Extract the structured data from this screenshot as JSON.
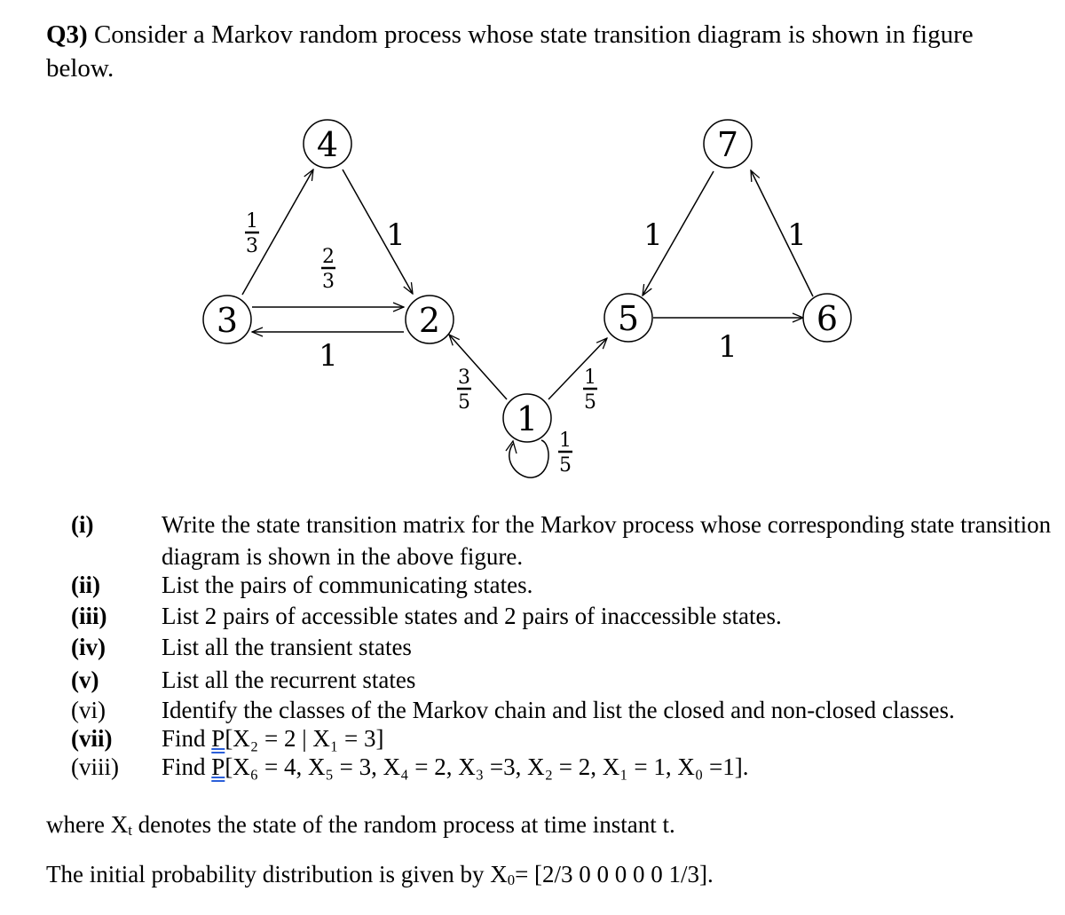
{
  "question": {
    "number": "Q3)",
    "text": "Consider a Markov random process whose state transition diagram is shown in figure below."
  },
  "diagram": {
    "states": [
      {
        "id": "1",
        "label": "1"
      },
      {
        "id": "2",
        "label": "2"
      },
      {
        "id": "3",
        "label": "3"
      },
      {
        "id": "4",
        "label": "4"
      },
      {
        "id": "5",
        "label": "5"
      },
      {
        "id": "6",
        "label": "6"
      },
      {
        "id": "7",
        "label": "7"
      }
    ],
    "transitions": [
      {
        "from": "3",
        "to": "4",
        "prob": "1/3",
        "num": "1",
        "den": "3"
      },
      {
        "from": "3",
        "to": "2",
        "prob": "2/3",
        "num": "2",
        "den": "3"
      },
      {
        "from": "2",
        "to": "3",
        "prob": "1"
      },
      {
        "from": "4",
        "to": "2",
        "prob": "1"
      },
      {
        "from": "1",
        "to": "2",
        "prob": "3/5",
        "num": "3",
        "den": "5"
      },
      {
        "from": "1",
        "to": "5",
        "prob": "1/5",
        "num": "1",
        "den": "5"
      },
      {
        "from": "1",
        "to": "1",
        "prob": "1/5",
        "num": "1",
        "den": "5"
      },
      {
        "from": "5",
        "to": "6",
        "prob": "1"
      },
      {
        "from": "6",
        "to": "7",
        "prob": "1"
      },
      {
        "from": "7",
        "to": "5",
        "prob": "1"
      }
    ]
  },
  "items": [
    {
      "label": "(i)",
      "bold": true,
      "text": "Write the state transition matrix for the Markov process whose corresponding state transition diagram is shown in the above figure."
    },
    {
      "label": "(ii)",
      "bold": true,
      "text": "List the pairs of communicating states."
    },
    {
      "label": "(iii)",
      "bold": true,
      "text": "List 2 pairs of accessible states and 2 pairs of inaccessible states."
    },
    {
      "label": "(iv)",
      "bold": true,
      "text": "List all the transient states"
    },
    {
      "label": "(v)",
      "bold": true,
      "text": "List all the recurrent states"
    },
    {
      "label": "(vi)",
      "bold": false,
      "text": "Identify the classes of the Markov chain and list the closed and non-closed classes."
    },
    {
      "label": "(vii)",
      "bold": true,
      "prefix": "Find ",
      "p": "P",
      "expr": "[X₂ = 2 | X₁ = 3]"
    },
    {
      "label": "(viii)",
      "bold": false,
      "prefix": "Find ",
      "p": "P",
      "expr": "[X₆ = 4, X₅ = 3, X₄ = 2, X₃ =3, X₂ = 2, X₁ = 1, X₀ =1]."
    }
  ],
  "footer": {
    "where_pre": "where X",
    "where_sub": "t",
    "where_post": " denotes the state of the random process at time instant t.",
    "initial_pre": "The initial probability distribution is given by X",
    "initial_sub": "0",
    "initial_post": "= [2/3 0 0 0 0 0 1/3]."
  }
}
